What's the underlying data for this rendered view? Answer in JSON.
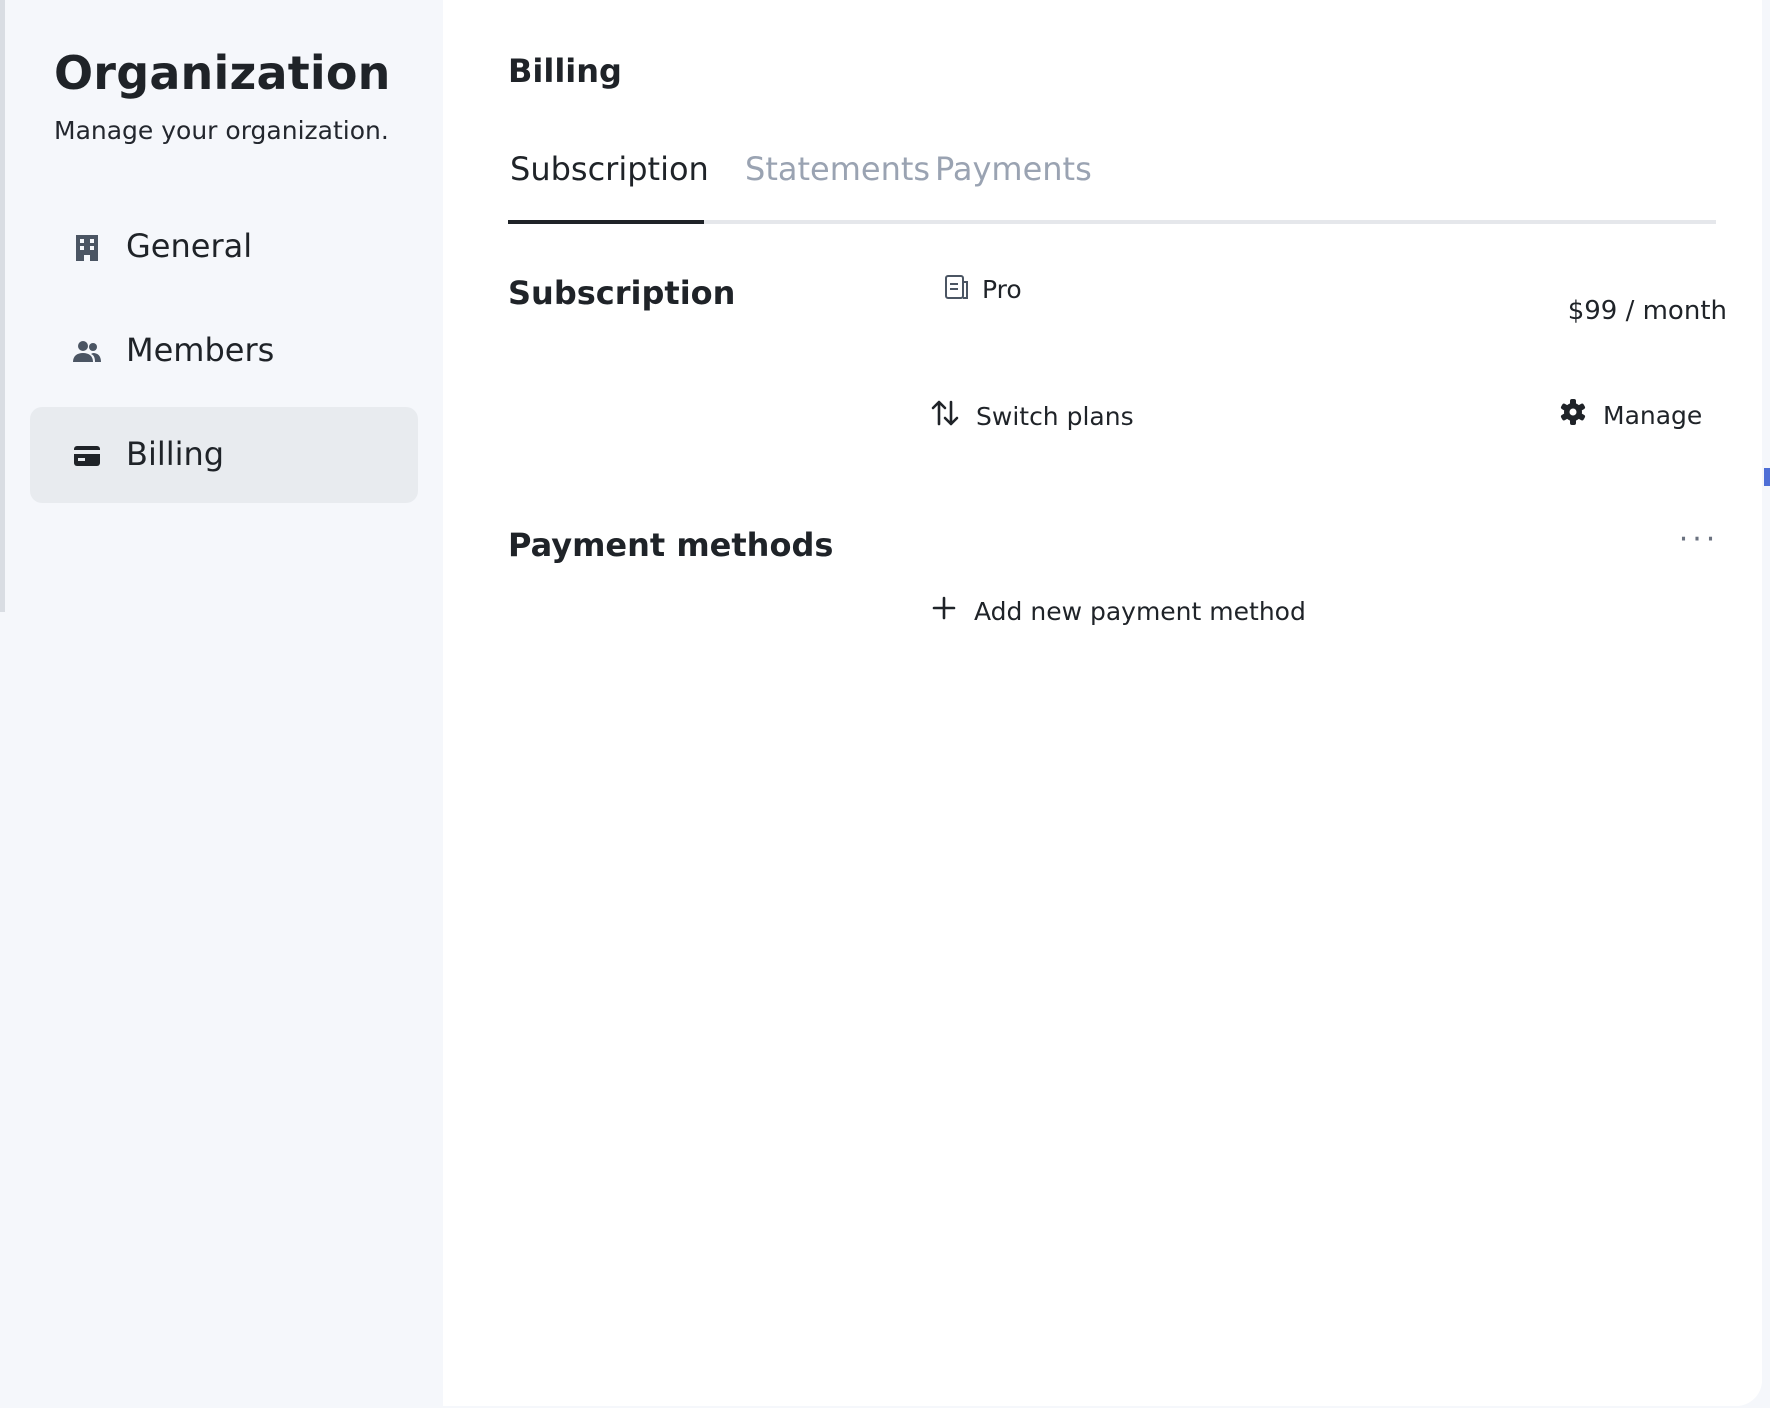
{
  "sidebar": {
    "title": "Organization",
    "subtitle": "Manage your organization.",
    "items": [
      {
        "label": "General",
        "icon": "building-icon",
        "active": false
      },
      {
        "label": "Members",
        "icon": "users-icon",
        "active": false
      },
      {
        "label": "Billing",
        "icon": "credit-card-icon",
        "active": true
      }
    ]
  },
  "main": {
    "title": "Billing",
    "tabs": [
      {
        "label": "Subscription",
        "active": true
      },
      {
        "label": "Statements",
        "active": false
      },
      {
        "label": "Payments",
        "active": false
      }
    ],
    "subscription": {
      "heading": "Subscription",
      "plan_name": "Pro",
      "plan_icon": "plan-document-icon",
      "price": "$99 / month",
      "switch_plans_label": "Switch plans",
      "manage_label": "Manage"
    },
    "payment_methods": {
      "heading": "Payment methods",
      "more_label": "···",
      "add_label": "Add new payment method"
    }
  },
  "colors": {
    "sidebar_bg": "#f5f7fb",
    "active_item_bg": "#e8ebef",
    "text": "#1f2328",
    "muted_tab": "#9aa3b2",
    "tab_border": "#e5e7eb"
  }
}
